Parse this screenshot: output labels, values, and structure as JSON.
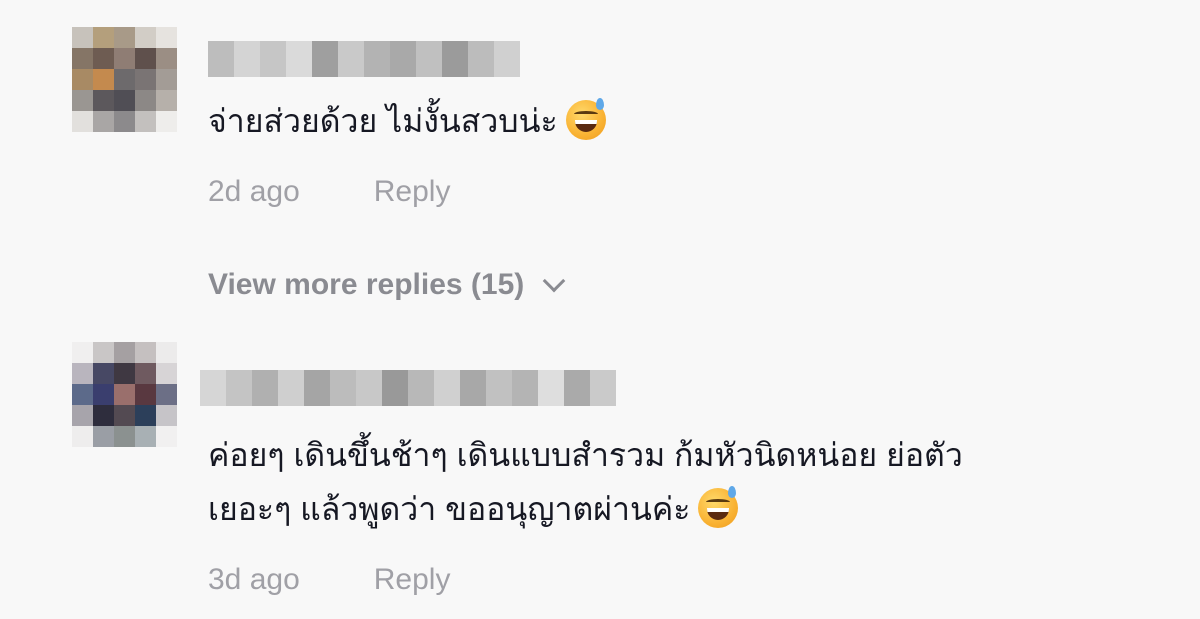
{
  "comments": [
    {
      "text": "จ่ายส่วยด้วย ไม่งั้นสวบน่ะ",
      "emoji": "grinning-sweat-emoji",
      "time": "2d ago",
      "reply_label": "Reply"
    },
    {
      "text_line1": "ค่อยๆ เดินขึ้นช้าๆ เดินแบบสำรวม ก้มหัวนิดหน่อย ย่อตัว",
      "text_line2": "เยอะๆ แล้วพูดว่า ขออนุญาตผ่านค่ะ",
      "emoji": "grinning-sweat-emoji",
      "time": "3d ago",
      "reply_label": "Reply"
    }
  ],
  "view_more": {
    "label": "View more replies (15)",
    "icon": "chevron-down-icon"
  },
  "colors": {
    "background": "#f8f8f8",
    "text": "#161823",
    "muted": "#a0a0a6",
    "view_more": "#8a8b91"
  }
}
